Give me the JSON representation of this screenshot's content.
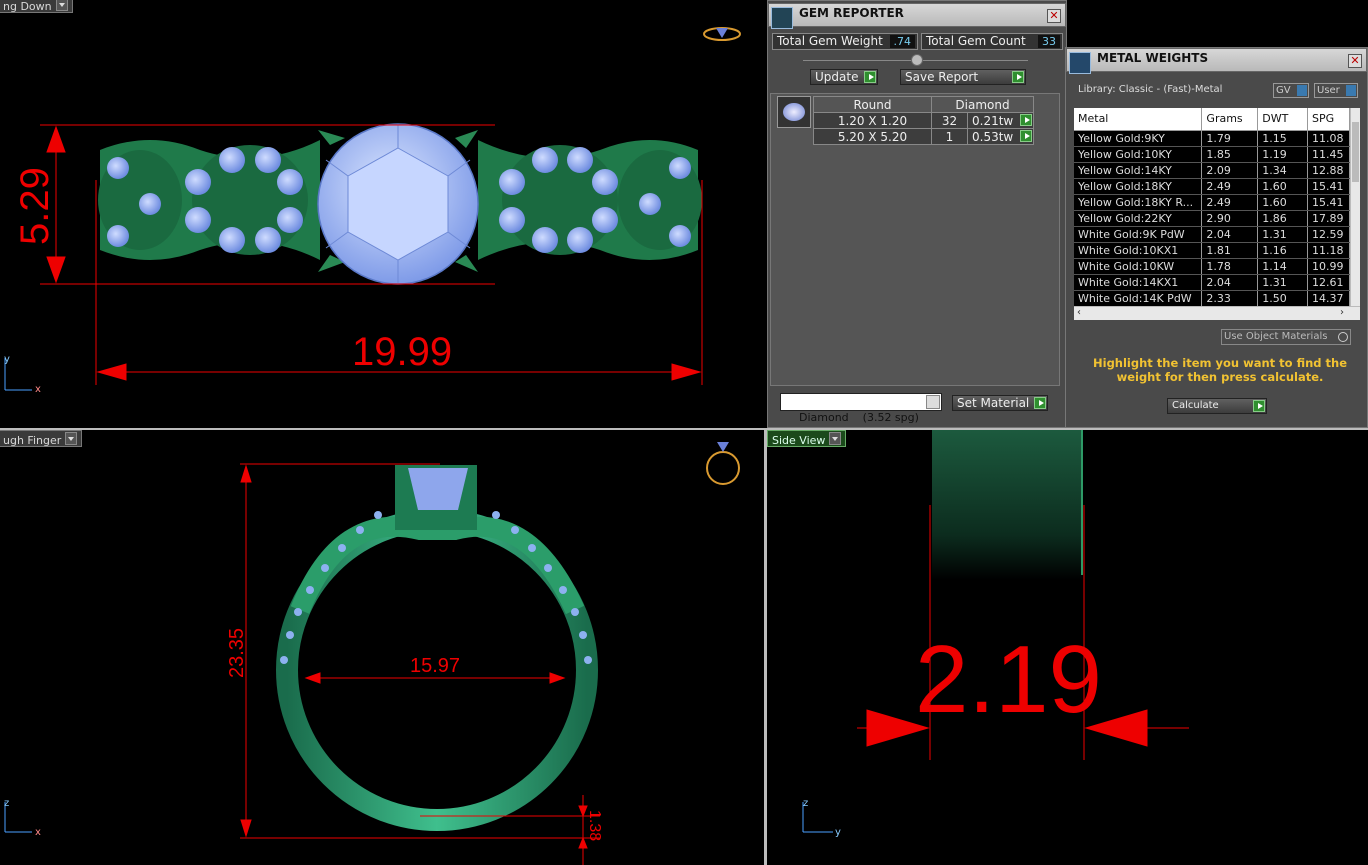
{
  "viewports": {
    "top": {
      "label": "ng Down"
    },
    "front": {
      "label": "ugh Finger"
    },
    "side": {
      "label": "Side View"
    }
  },
  "dimensions": {
    "top_height": "5.29",
    "top_width": "19.99",
    "front_height": "23.35",
    "front_inner": "15.97",
    "front_thickness": "1.38",
    "side_width": "2.19"
  },
  "axes": {
    "top": [
      "y",
      "x"
    ],
    "front": [
      "z",
      "x"
    ],
    "side": [
      "z",
      "y"
    ]
  },
  "gem_reporter": {
    "title": "GEM REPORTER",
    "total_weight_label": "Total Gem Weight",
    "total_weight_value": ".74",
    "total_count_label": "Total Gem Count",
    "total_count_value": "33",
    "update_label": "Update",
    "save_label": "Save Report",
    "table": {
      "headers": [
        "Round",
        "Diamond"
      ],
      "rows": [
        {
          "size": "1.20 X 1.20",
          "count": "32",
          "weight": "0.21tw"
        },
        {
          "size": "5.20 X 5.20",
          "count": "1",
          "weight": "0.53tw"
        }
      ]
    },
    "material_select": "Diamond    (3.52 spg)",
    "set_material_label": "Set Material"
  },
  "metal_weights": {
    "title": "METAL WEIGHTS",
    "library": "Library: Classic - (Fast)-Metal",
    "toggle_gv": "GV",
    "toggle_user": "User",
    "headers": [
      "Metal",
      "Grams",
      "DWT",
      "SPG"
    ],
    "rows": [
      [
        "Yellow Gold:9KY",
        "1.79",
        "1.15",
        "11.08"
      ],
      [
        "Yellow Gold:10KY",
        "1.85",
        "1.19",
        "11.45"
      ],
      [
        "Yellow Gold:14KY",
        "2.09",
        "1.34",
        "12.88"
      ],
      [
        "Yellow Gold:18KY",
        "2.49",
        "1.60",
        "15.41"
      ],
      [
        "Yellow Gold:18KY R...",
        "2.49",
        "1.60",
        "15.41"
      ],
      [
        "Yellow Gold:22KY",
        "2.90",
        "1.86",
        "17.89"
      ],
      [
        "White Gold:9K PdW",
        "2.04",
        "1.31",
        "12.59"
      ],
      [
        "White Gold:10KX1",
        "1.81",
        "1.16",
        "11.18"
      ],
      [
        "White Gold:10KW",
        "1.78",
        "1.14",
        "10.99"
      ],
      [
        "White Gold:14KX1",
        "2.04",
        "1.31",
        "12.61"
      ],
      [
        "White Gold:14K PdW",
        "2.33",
        "1.50",
        "14.37"
      ]
    ],
    "use_object_materials": "Use Object Materials",
    "hint": "Highlight the item you want to find the weight for then press calculate.",
    "calculate_label": "Calculate"
  }
}
